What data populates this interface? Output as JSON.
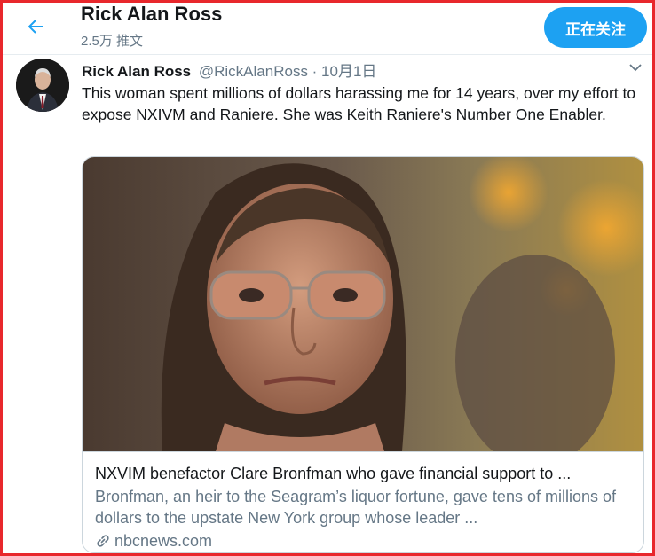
{
  "header": {
    "name": "Rick Alan Ross",
    "tweet_count": "2.5万 推文",
    "follow_button": "正在关注"
  },
  "tweet": {
    "author_name": "Rick Alan Ross",
    "handle_date": "@RickAlanRoss · 10月1日",
    "text": "This woman spent millions of dollars harassing me for 14 years, over my effort to expose NXIVM and Raniere. She was Keith Raniere's Number One Enabler."
  },
  "card": {
    "title": "NXVIM benefactor Clare Bronfman who gave financial support to ...",
    "description": "Bronfman, an heir to the Seagram’s liquor fortune, gave tens of millions of dollars to the upstate New York group whose leader ...",
    "domain": "nbcnews.com"
  },
  "colors": {
    "accent": "#1da1f2",
    "border_frame": "#e8272c",
    "secondary_text": "#657786"
  },
  "icons": [
    "back-arrow-icon",
    "chevron-down-icon",
    "link-icon"
  ]
}
